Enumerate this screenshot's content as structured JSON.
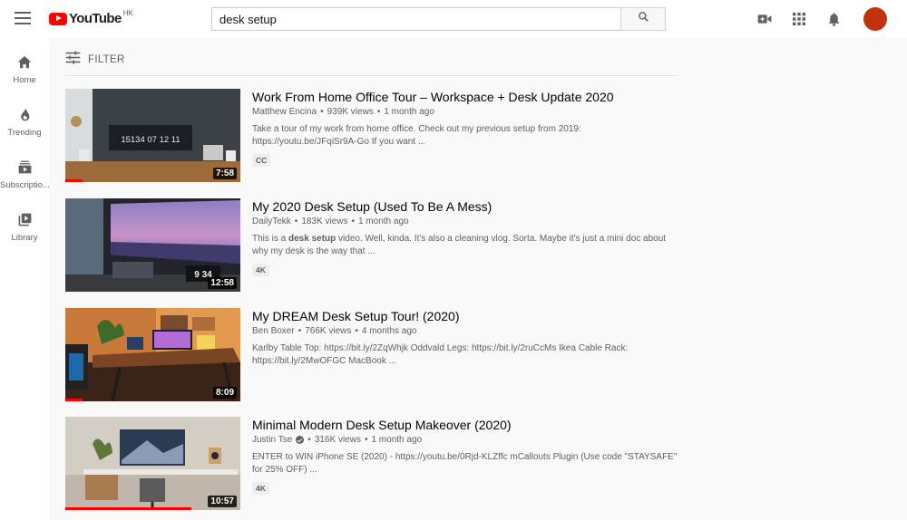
{
  "brand": {
    "name": "YouTube",
    "region": "HK",
    "accent": "#ff0000"
  },
  "search": {
    "value": "desk setup",
    "icon": "search-icon"
  },
  "header_icons": [
    "video-camera-icon",
    "apps-grid-icon",
    "bell-icon"
  ],
  "sidebar": {
    "items": [
      {
        "label": "Home",
        "icon": "home-icon"
      },
      {
        "label": "Trending",
        "icon": "flame-icon"
      },
      {
        "label": "Subscriptio...",
        "icon": "subscriptions-icon"
      },
      {
        "label": "Library",
        "icon": "library-icon"
      }
    ]
  },
  "filter": {
    "label": "FILTER",
    "icon": "sliders-icon"
  },
  "results": [
    {
      "title": "Work From Home Office Tour – Workspace + Desk Update 2020",
      "channel": "Matthew Encina",
      "verified": false,
      "views": "939K views",
      "age": "1 month ago",
      "desc_pre": "Take a tour of my work from home office. Check out my previous setup from 2019: https://youtu.be/JFqiSr9A-Go If you want ...",
      "desc_bold": "",
      "desc_post": "",
      "badge": "CC",
      "duration": "7:58",
      "watched_fraction": 0.1,
      "clock_text": "15134 07 12 11"
    },
    {
      "title": "My 2020 Desk Setup (Used To Be A Mess)",
      "channel": "DailyTekk",
      "verified": false,
      "views": "183K views",
      "age": "1 month ago",
      "desc_pre": "This is a ",
      "desc_bold": "desk setup",
      "desc_post": " video. Well, kinda. It's also a cleaning vlog. Sorta. Maybe it's just a mini doc about why my desk is the way that ...",
      "badge": "4K",
      "duration": "12:58",
      "watched_fraction": 0,
      "clock_text": "9 34"
    },
    {
      "title": "My DREAM Desk Setup Tour! (2020)",
      "channel": "Ben Boxer",
      "verified": false,
      "views": "766K views",
      "age": "4 months ago",
      "desc_pre": "Karlby Table Top: https://bit.ly/2ZqWhjk Oddvald Legs: https://bit.ly/2ruCcMs Ikea Cable Rack: https://bit.ly/2MwOFGC MacBook ...",
      "desc_bold": "",
      "desc_post": "",
      "badge": "",
      "duration": "8:09",
      "watched_fraction": 0.1,
      "clock_text": ""
    },
    {
      "title": "Minimal Modern Desk Setup Makeover (2020)",
      "channel": "Justin Tse",
      "verified": true,
      "views": "316K views",
      "age": "1 month ago",
      "desc_pre": "ENTER to WIN iPhone SE (2020) - https://youtu.be/0Rjd-KLZffc mCallouts Plugin (Use code \"STAYSAFE\" for 25% OFF) ...",
      "desc_bold": "",
      "desc_post": "",
      "badge": "4K",
      "duration": "10:57",
      "watched_fraction": 0.72,
      "clock_text": ""
    }
  ]
}
